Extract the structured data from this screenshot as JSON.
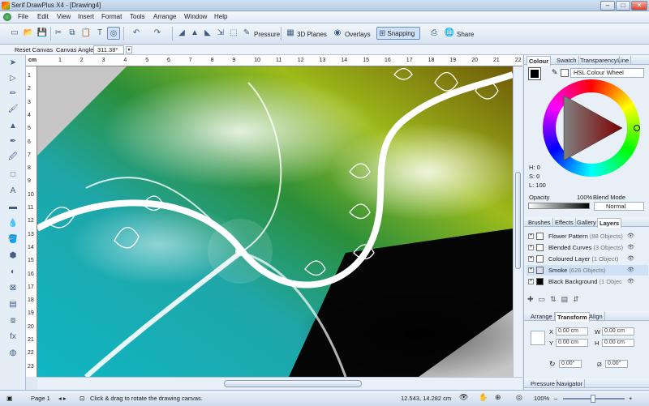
{
  "window": {
    "title": "Serif DrawPlus X4 - [Drawing4]",
    "min": "–",
    "max": "□",
    "close": "✕"
  },
  "menu": [
    {
      "label": "File"
    },
    {
      "label": "Edit"
    },
    {
      "label": "View"
    },
    {
      "label": "Insert"
    },
    {
      "label": "Format"
    },
    {
      "label": "Tools"
    },
    {
      "label": "Arrange"
    },
    {
      "label": "Window"
    },
    {
      "label": "Help"
    }
  ],
  "toolbar": {
    "pressure_label": "Pressure",
    "planes_label": "3D Planes",
    "overlays_label": "Overlays",
    "snapping_label": "Snapping",
    "share_label": "Share"
  },
  "context": {
    "reset_label": "Reset Canvas",
    "angle_label": "Canvas Angle",
    "angle_value": "311.38°"
  },
  "ruler": {
    "unit": "cm",
    "top": [
      "1",
      "2",
      "3",
      "4",
      "5",
      "6",
      "7",
      "8",
      "9",
      "10",
      "11",
      "12",
      "13",
      "14",
      "15",
      "16",
      "17",
      "18",
      "19",
      "20",
      "21",
      "22"
    ],
    "left": [
      "1",
      "2",
      "3",
      "4",
      "5",
      "6",
      "7",
      "8",
      "9",
      "10",
      "11",
      "12",
      "13",
      "14",
      "15",
      "16",
      "17",
      "18",
      "19",
      "20",
      "21",
      "22",
      "23"
    ]
  },
  "status": {
    "page": "Page 1",
    "hint": "Click & drag to rotate the drawing canvas.",
    "coords": "12.543, 14.282 cm",
    "zoom": "100%"
  },
  "panel": {
    "colour_tabs": [
      "Colour",
      "Swatch",
      "Transparency",
      "Line"
    ],
    "wheel_mode": "HSL Colour Wheel",
    "h": "H: 0",
    "s": "S: 0",
    "l": "L: 100",
    "opacity_label": "Opacity",
    "opacity_value": "100%",
    "blend_label": "Blend Mode",
    "blend_value": "Normal",
    "layer_tabs": [
      "Brushes",
      "Effects",
      "Gallery",
      "Layers"
    ],
    "layers": [
      {
        "name": "Flower Pattern",
        "count": "(88 Objects)"
      },
      {
        "name": "Blended Curves",
        "count": "(3 Objects)"
      },
      {
        "name": "Coloured Layer",
        "count": "(1 Object)"
      },
      {
        "name": "Smoke",
        "count": "(626 Objects)"
      },
      {
        "name": "Black Background",
        "count": "(1 Objec"
      }
    ],
    "transform_tabs": [
      "Arrange",
      "Transform",
      "Align"
    ],
    "x_label": "X",
    "x_value": "0.00 cm",
    "y_label": "Y",
    "y_value": "0.00 cm",
    "w_label": "W",
    "w_value": "0.00 cm",
    "h_label": "H",
    "h_value": "0.00 cm",
    "rot_value": "0.00°",
    "shear_value": "0.00°",
    "bottom_tabs": [
      "Pressure",
      "Navigator"
    ]
  },
  "colors": {
    "accent": "#3a6ea5",
    "panel_bg": "#e8eff7"
  }
}
